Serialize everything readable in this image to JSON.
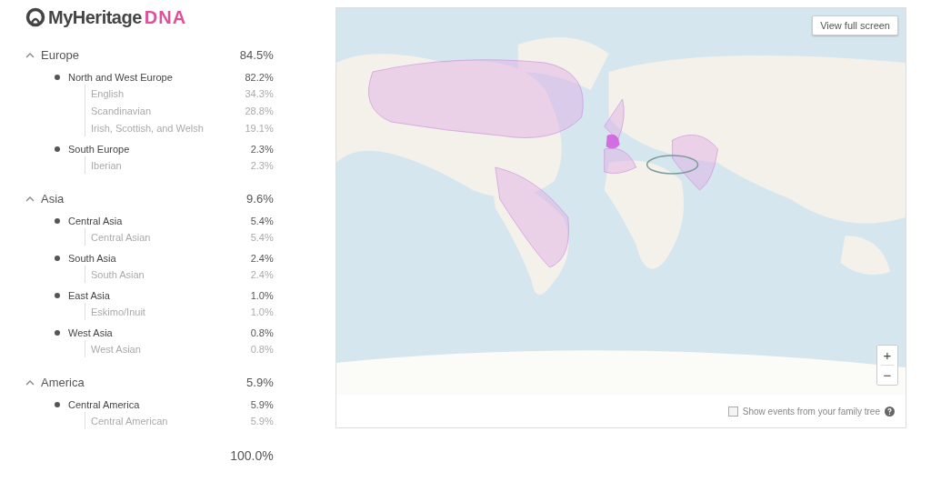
{
  "logo": {
    "name": "MyHeritage",
    "suffix": "DNA"
  },
  "regions": [
    {
      "name": "Europe",
      "percent": "84.5%",
      "expanded": true,
      "children": [
        {
          "name": "North and West Europe",
          "percent": "82.2%",
          "children": [
            {
              "name": "English",
              "percent": "34.3%"
            },
            {
              "name": "Scandinavian",
              "percent": "28.8%"
            },
            {
              "name": "Irish, Scottish, and Welsh",
              "percent": "19.1%"
            }
          ]
        },
        {
          "name": "South Europe",
          "percent": "2.3%",
          "children": [
            {
              "name": "Iberian",
              "percent": "2.3%"
            }
          ]
        }
      ]
    },
    {
      "name": "Asia",
      "percent": "9.6%",
      "expanded": true,
      "children": [
        {
          "name": "Central Asia",
          "percent": "5.4%",
          "children": [
            {
              "name": "Central Asian",
              "percent": "5.4%"
            }
          ]
        },
        {
          "name": "South Asia",
          "percent": "2.4%",
          "children": [
            {
              "name": "South Asian",
              "percent": "2.4%"
            }
          ]
        },
        {
          "name": "East Asia",
          "percent": "1.0%",
          "children": [
            {
              "name": "Eskimo/Inuit",
              "percent": "1.0%"
            }
          ]
        },
        {
          "name": "West Asia",
          "percent": "0.8%",
          "children": [
            {
              "name": "West Asian",
              "percent": "0.8%"
            }
          ]
        }
      ]
    },
    {
      "name": "America",
      "percent": "5.9%",
      "expanded": true,
      "children": [
        {
          "name": "Central America",
          "percent": "5.9%",
          "children": [
            {
              "name": "Central American",
              "percent": "5.9%"
            }
          ]
        }
      ]
    }
  ],
  "total": "100.0%",
  "map": {
    "fullscreen_button": "View full screen",
    "zoom_in": "+",
    "zoom_out": "−",
    "family_tree_option": {
      "label": "Show events from your family tree",
      "checked": false
    }
  }
}
